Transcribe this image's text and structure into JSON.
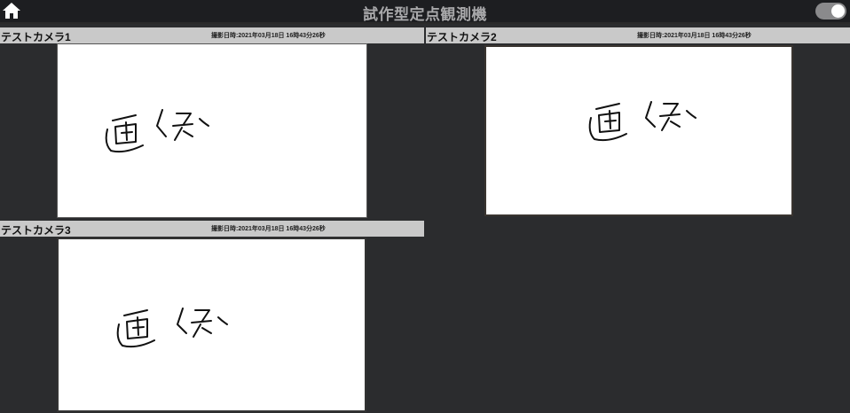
{
  "app": {
    "title": "試作型定点観測機",
    "home_icon": "home-icon",
    "toggle_icon": "toggle-switch",
    "toggle_on": true
  },
  "cameras": [
    {
      "name": "テストカメラ1",
      "timestamp": "撮影日時:2021年03月18日 16時43分26秒"
    },
    {
      "name": "テストカメラ2",
      "timestamp": "撮影日時:2021年03月18日 16時43分26秒"
    },
    {
      "name": "テストカメラ3",
      "timestamp": "撮影日時:2021年03月18日 16時43分26秒"
    }
  ]
}
